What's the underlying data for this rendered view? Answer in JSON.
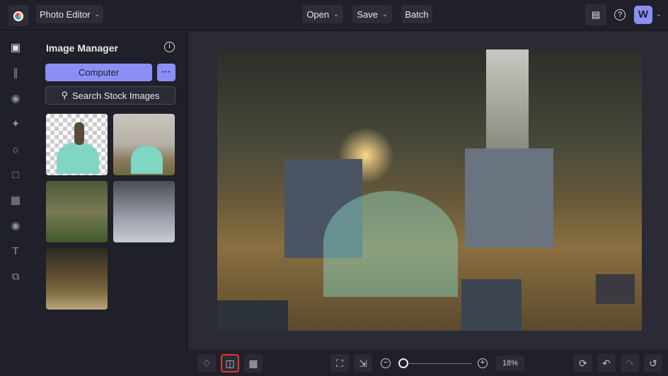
{
  "topbar": {
    "app_title": "Photo Editor",
    "open": "Open",
    "save": "Save",
    "batch": "Batch",
    "avatar": "W"
  },
  "panel": {
    "title": "Image Manager",
    "computer": "Computer",
    "more": "···",
    "search": "Search Stock Images"
  },
  "bottombar": {
    "zoom": "18%",
    "zoom_fraction": 0.02
  },
  "rail": [
    "image",
    "adjustments",
    "effects",
    "touch-up",
    "artsy",
    "frames",
    "graphics",
    "overlays",
    "text",
    "textures"
  ]
}
